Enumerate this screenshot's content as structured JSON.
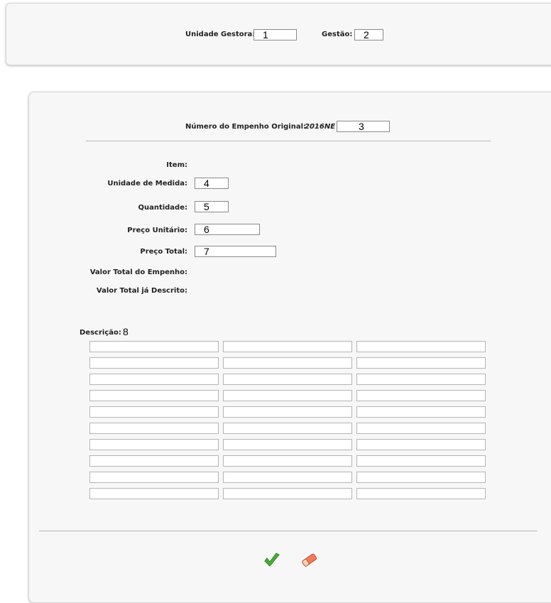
{
  "header": {
    "unidade_gestora_label": "Unidade Gestora:",
    "unidade_gestora_value": "1",
    "gestao_label": "Gestão:",
    "gestao_value": "2"
  },
  "form": {
    "empenho_label": "Número do Empenho Original:",
    "empenho_prefix": "2016NE",
    "empenho_value": "3",
    "item_label": "Item:",
    "unidade_medida_label": "Unidade de Medida:",
    "unidade_medida_value": "4",
    "quantidade_label": "Quantidade:",
    "quantidade_value": "5",
    "preco_unitario_label": "Preço Unitário:",
    "preco_unitario_value": "6",
    "preco_total_label": "Preço Total:",
    "preco_total_value": "7",
    "valor_total_empenho_label": "Valor Total do Empenho:",
    "valor_total_descrito_label": "Valor Total já Descrito:",
    "descricao_label": "Descrição:",
    "descricao_marker": "8",
    "descricao_grid": {
      "rows": 10,
      "columns": 3
    }
  },
  "actions": {
    "confirm_icon": "checkmark-icon",
    "clear_icon": "eraser-icon",
    "colors": {
      "confirm": "#4caf3c",
      "clear": "#f07a5a"
    }
  }
}
